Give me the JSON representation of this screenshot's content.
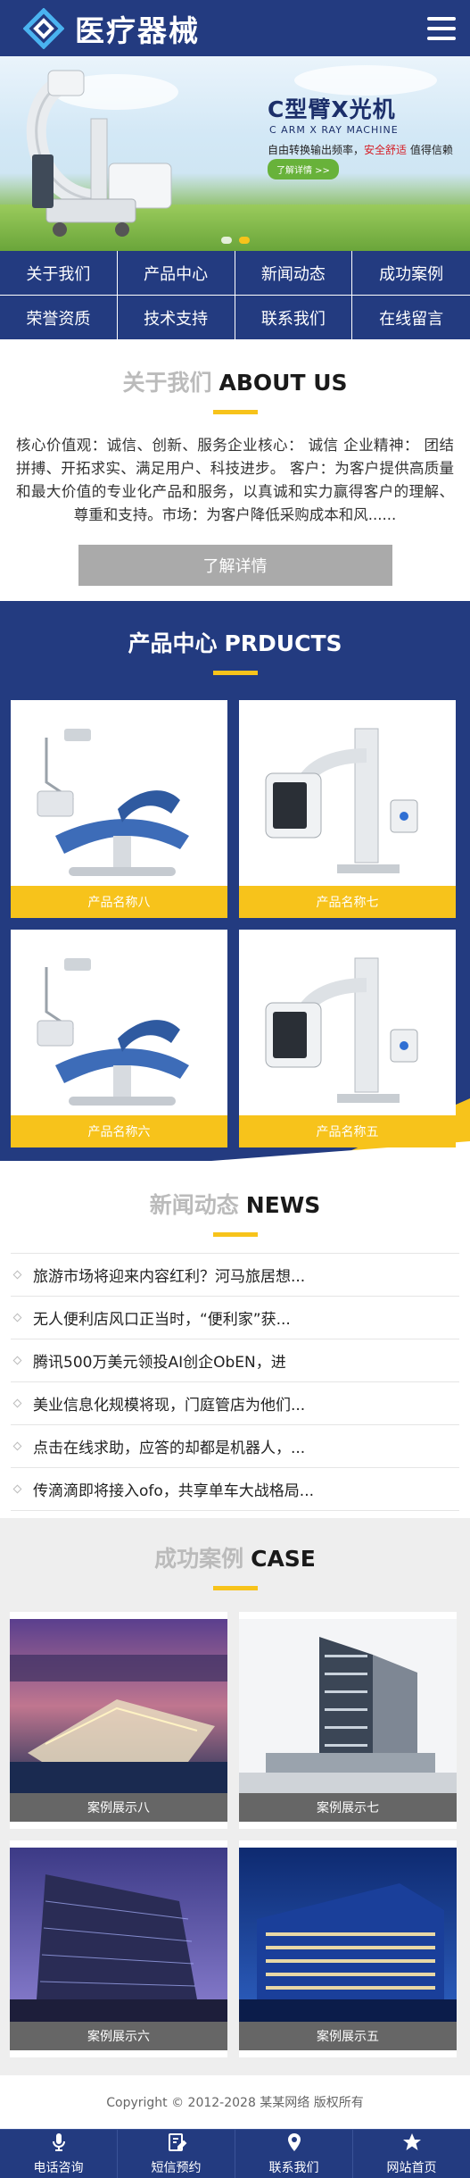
{
  "header": {
    "logo_text": "医疗器械",
    "logo_icon": "diamond-logo-icon",
    "menu_icon": "hamburger-menu-icon"
  },
  "banner": {
    "title": "C型臂X光机",
    "subtitle": "C ARM X RAY MACHINE",
    "desc_prefix": "自由转换输出频率，",
    "desc_highlight": "安全舒适",
    "desc_suffix": "值得信赖",
    "button": "了解详情 >>",
    "active_slide": 2,
    "slide_count": 2
  },
  "nav": [
    {
      "label": "关于我们"
    },
    {
      "label": "产品中心"
    },
    {
      "label": "新闻动态"
    },
    {
      "label": "成功案例"
    },
    {
      "label": "荣誉资质"
    },
    {
      "label": "技术支持"
    },
    {
      "label": "联系我们"
    },
    {
      "label": "在线留言"
    }
  ],
  "about": {
    "title_cn": "关于我们",
    "title_en": "ABOUT US",
    "text": "核心价值观：诚信、创新、服务企业核心： 诚信 企业精神： 团结拼搏、开拓求实、满足用户、科技进步。 客户：为客户提供高质量和最大价值的专业化产品和服务，以真诚和实力赢得客户的理解、尊重和支持。市场：为客户降低采购成本和风......",
    "button": "了解详情"
  },
  "products": {
    "title_cn": "产品中心",
    "title_en": "PRDUCTS",
    "items": [
      {
        "label": "产品名称八",
        "kind": "dental-chair"
      },
      {
        "label": "产品名称七",
        "kind": "xray-stand"
      },
      {
        "label": "产品名称六",
        "kind": "dental-chair"
      },
      {
        "label": "产品名称五",
        "kind": "xray-stand"
      }
    ]
  },
  "news": {
    "title_cn": "新闻动态",
    "title_en": "NEWS",
    "items": [
      {
        "title": "旅游市场将迎来内容红利？河马旅居想..."
      },
      {
        "title": "无人便利店风口正当时，“便利家”获..."
      },
      {
        "title": "腾讯500万美元领投AI创企ObEN，进"
      },
      {
        "title": "美业信息化规模将现，门庭管店为他们..."
      },
      {
        "title": "点击在线求助，应答的却都是机器人，..."
      },
      {
        "title": "传滴滴即将接入ofo，共享单车大战格局..."
      }
    ]
  },
  "cases": {
    "title_cn": "成功案例",
    "title_en": "CASE",
    "items": [
      {
        "label": "案例展示八",
        "kind": "night-waterfront"
      },
      {
        "label": "案例展示七",
        "kind": "office-tower"
      },
      {
        "label": "案例展示六",
        "kind": "modern-building"
      },
      {
        "label": "案例展示五",
        "kind": "lit-office"
      }
    ]
  },
  "footer": {
    "copyright": "Copyright © 2012-2028 某某网络 版权所有"
  },
  "bottom_bar": [
    {
      "label": "电话咨询",
      "icon": "microphone-icon"
    },
    {
      "label": "短信预约",
      "icon": "edit-icon"
    },
    {
      "label": "联系我们",
      "icon": "location-pin-icon"
    },
    {
      "label": "网站首页",
      "icon": "star-icon"
    }
  ],
  "colors": {
    "primary": "#233b80",
    "accent": "#f7c31b",
    "gray_button": "#aaaaaa"
  }
}
